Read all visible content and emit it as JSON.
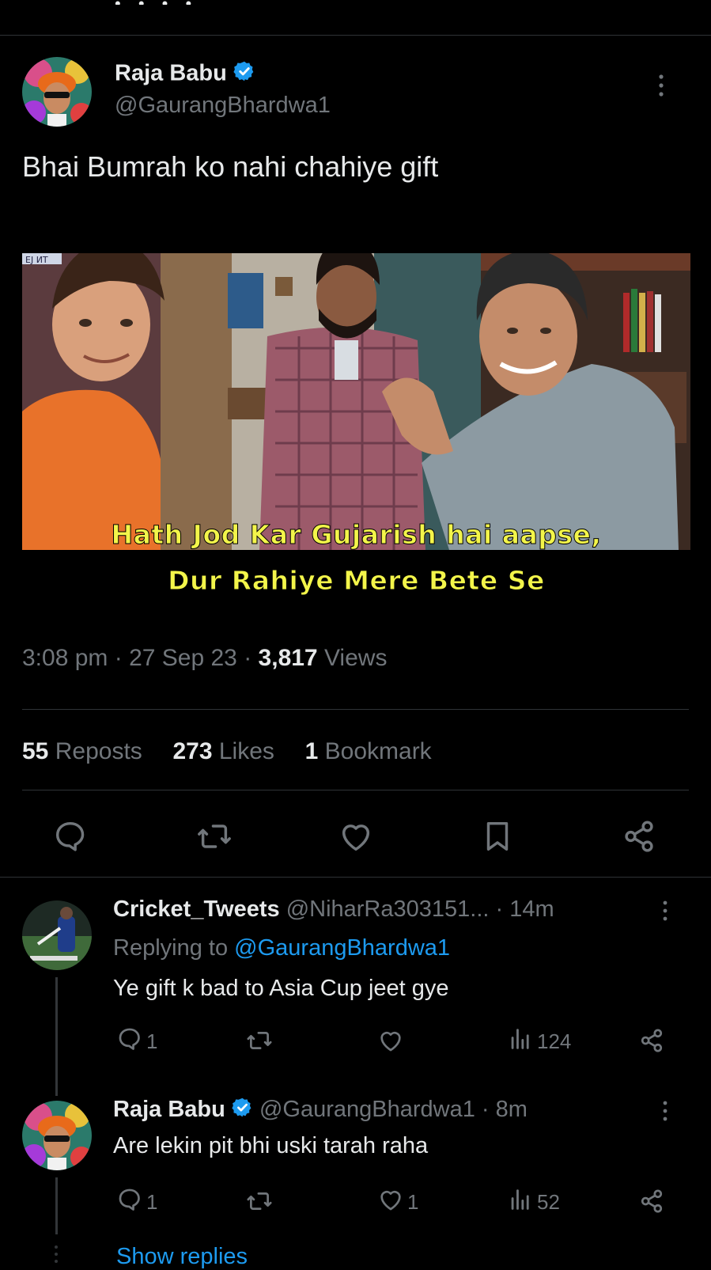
{
  "top_partial_text": "",
  "main_tweet": {
    "author_name": "Raja Babu",
    "handle": "@GaurangBhardwa1",
    "text": "Bhai Bumrah ko nahi chahiye gift",
    "meme_caption_line1": "Hath Jod Kar Gujarish hai aapse,",
    "meme_caption_line2": "Dur Rahiye Mere Bete Se",
    "meme_sign_text": "EJ ИT",
    "time": "3:08 pm",
    "date": "27 Sep 23",
    "views_count": "3,817",
    "views_label": "Views",
    "reposts_count": "55",
    "reposts_label": "Reposts",
    "likes_count": "273",
    "likes_label": "Likes",
    "bookmarks_count": "1",
    "bookmarks_label": "Bookmark",
    "icons": [
      "reply-icon",
      "repost-icon",
      "like-icon",
      "bookmark-icon",
      "share-icon"
    ]
  },
  "replies": [
    {
      "author_name": "Cricket_Tweets",
      "handle": "@NiharRa303151...",
      "time": "· 14m",
      "replying_prefix": "Replying to",
      "replying_to": "@GaurangBhardwa1",
      "text": "Ye gift k bad to Asia Cup jeet gye",
      "reply_count": "1",
      "repost_count": "",
      "like_count": "",
      "views_count": "124"
    },
    {
      "author_name": "Raja Babu",
      "handle": "@GaurangBhardwa1",
      "time": "· 8m",
      "text": "Are lekin pit bhi uski tarah raha",
      "reply_count": "1",
      "repost_count": "",
      "like_count": "1",
      "views_count": "52"
    }
  ],
  "show_replies_label": "Show replies",
  "colors": {
    "background": "#000000",
    "text": "#e7e9ea",
    "muted": "#71767b",
    "accent": "#1d9bf0",
    "divider": "#2f3336",
    "caption": "#f3f54a"
  }
}
